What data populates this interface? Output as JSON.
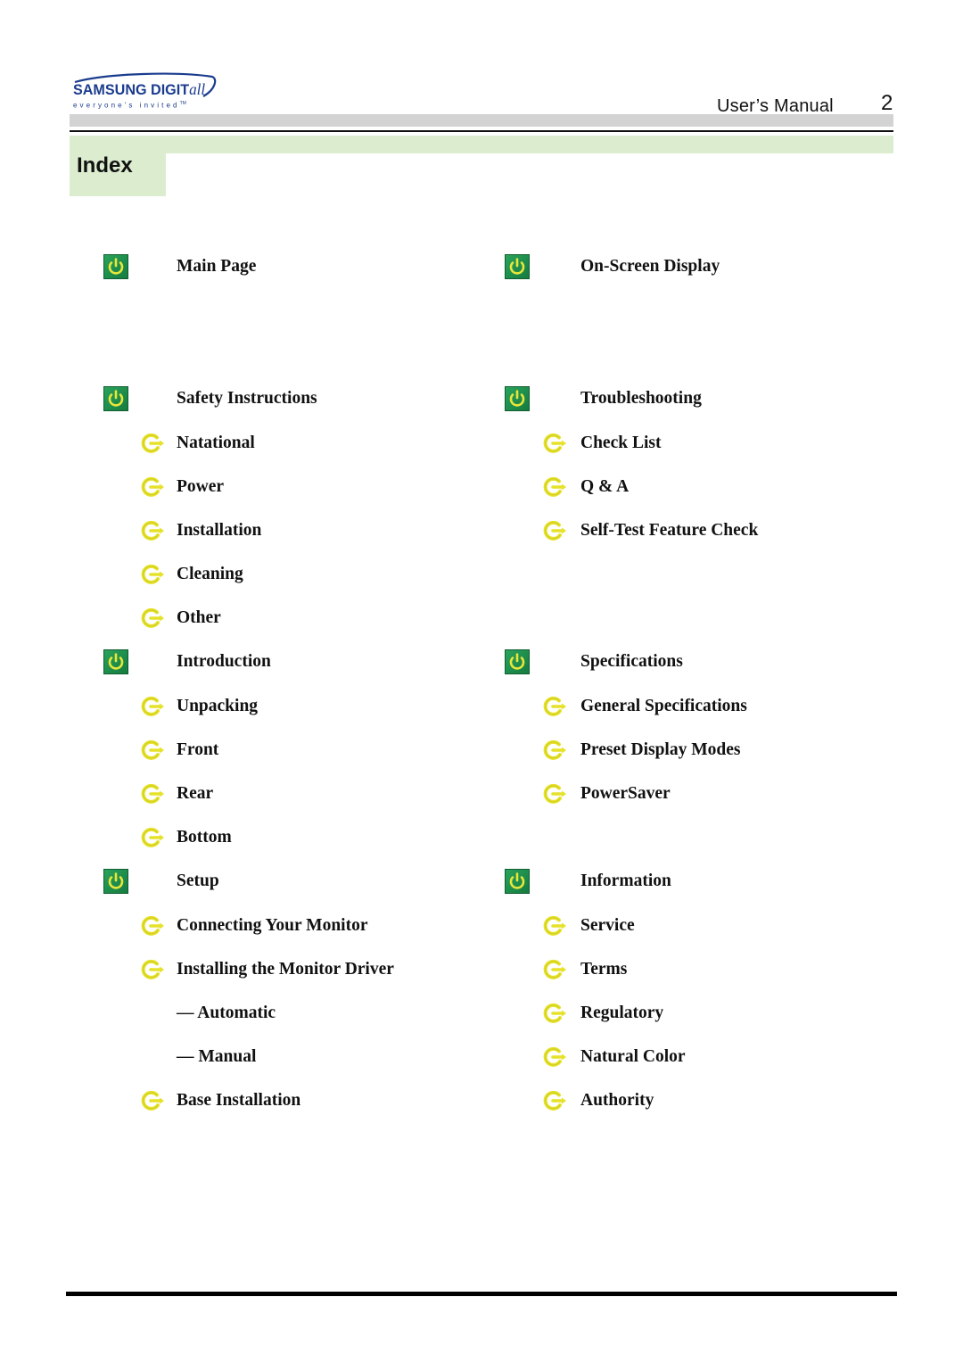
{
  "header": {
    "logo_brand": "SAMSUNG DIGIT",
    "logo_brand_suffix": "all",
    "logo_tagline": "everyone's invited",
    "logo_tm": "TM",
    "manual_title": "User’s  Manual",
    "page_number": "2",
    "section_title": "Index"
  },
  "colors": {
    "accent_green": "#dbeccf",
    "header_gray": "#d3d3d3",
    "section_icon_green": "#1e8a4c",
    "icon_yellow": "#e6e22a",
    "brand_blue": "#1b3c8e"
  },
  "columns": [
    {
      "sections": [
        {
          "title": "Main Page",
          "icon": "power-icon",
          "items": []
        },
        {
          "title": "Safety Instructions",
          "icon": "power-icon",
          "items": [
            {
              "label": "Natational",
              "icon": "arrow-circle-icon"
            },
            {
              "label": "Power",
              "icon": "arrow-circle-icon"
            },
            {
              "label": "Installation",
              "icon": "arrow-circle-icon"
            },
            {
              "label": "Cleaning",
              "icon": "arrow-circle-icon"
            },
            {
              "label": "Other",
              "icon": "arrow-circle-icon"
            }
          ]
        },
        {
          "title": "Introduction",
          "icon": "power-icon",
          "items": [
            {
              "label": "Unpacking",
              "icon": "arrow-circle-icon"
            },
            {
              "label": "Front",
              "icon": "arrow-circle-icon"
            },
            {
              "label": "Rear",
              "icon": "arrow-circle-icon"
            },
            {
              "label": "Bottom",
              "icon": "arrow-circle-icon"
            }
          ]
        },
        {
          "title": "Setup",
          "icon": "power-icon",
          "items": [
            {
              "label": "Connecting Your Monitor",
              "icon": "arrow-circle-icon"
            },
            {
              "label": "Installing the Monitor Driver",
              "icon": "arrow-circle-icon"
            },
            {
              "label": "— Automatic",
              "icon": null
            },
            {
              "label": "— Manual",
              "icon": null
            },
            {
              "label": "Base Installation",
              "icon": "arrow-circle-icon"
            }
          ]
        }
      ]
    },
    {
      "sections": [
        {
          "title": "On-Screen Display",
          "icon": "power-icon",
          "items": []
        },
        {
          "title": "Troubleshooting",
          "icon": "power-icon",
          "items": [
            {
              "label": "Check List",
              "icon": "arrow-circle-icon"
            },
            {
              "label": "Q & A",
              "icon": "arrow-circle-icon"
            },
            {
              "label": "Self-Test Feature Check",
              "icon": "arrow-circle-icon"
            }
          ]
        },
        {
          "title": "Specifications",
          "icon": "power-icon",
          "items": [
            {
              "label": "General Specifications",
              "icon": "arrow-circle-icon"
            },
            {
              "label": "Preset Display Modes",
              "icon": "arrow-circle-icon"
            },
            {
              "label": "PowerSaver",
              "icon": "arrow-circle-icon"
            }
          ]
        },
        {
          "title": "Information",
          "icon": "power-icon",
          "items": [
            {
              "label": "Service",
              "icon": "arrow-circle-icon"
            },
            {
              "label": "Terms",
              "icon": "arrow-circle-icon"
            },
            {
              "label": "Regulatory",
              "icon": "arrow-circle-icon"
            },
            {
              "label": "Natural Color",
              "icon": "arrow-circle-icon"
            },
            {
              "label": "Authority",
              "icon": "arrow-circle-icon"
            }
          ]
        }
      ]
    }
  ]
}
